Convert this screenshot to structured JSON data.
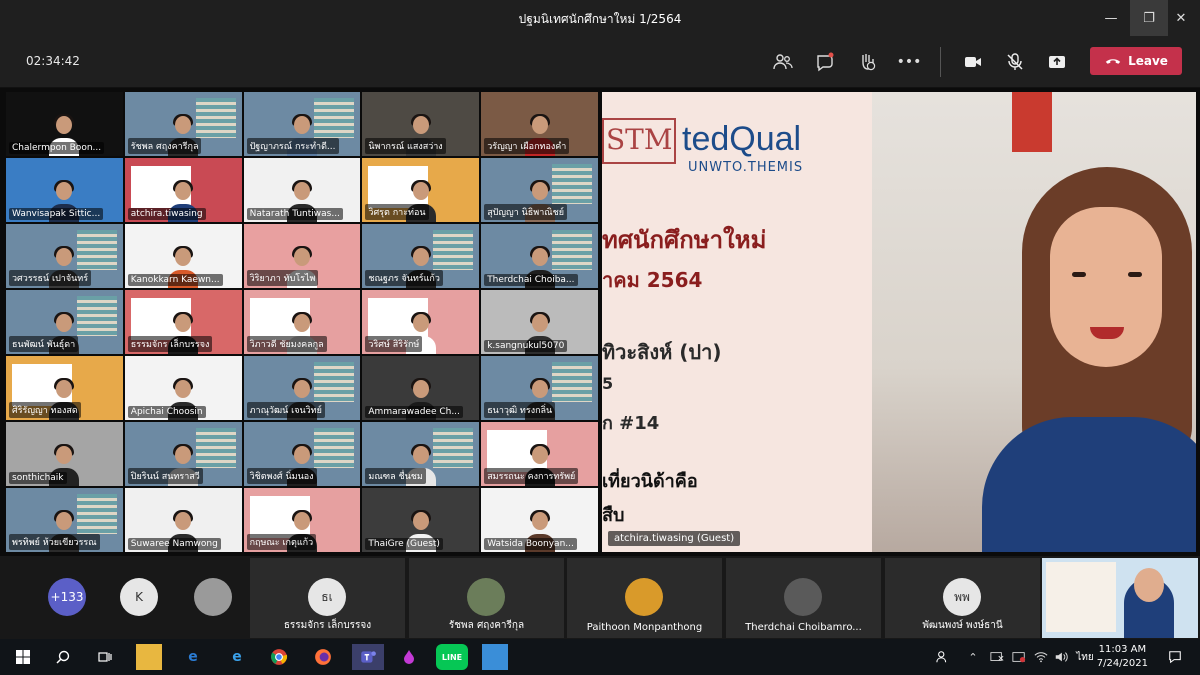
{
  "window": {
    "title": "ปฐมนิเทศนักศึกษาใหม่ 1/2564",
    "minimize": "—",
    "restore": "❐",
    "close": "✕"
  },
  "toolbar": {
    "timer": "02:34:42",
    "leave_label": "Leave",
    "more": "•••"
  },
  "grid": {
    "tiles": [
      {
        "name": "Chalermpon Boon...",
        "bg": "#111111",
        "shirt": "#ffffff"
      },
      {
        "name": "รัชพล ศฤงคารีกุล",
        "bg": "#6d8aa3",
        "shirt": "#2b2b2b"
      },
      {
        "name": "ปัฐญาภรณ์ กระทำดี...",
        "bg": "#6d8aa3",
        "shirt": "#5a7aa0"
      },
      {
        "name": "นิพากรณ์ แสงสว่าง",
        "bg": "#4e4a44",
        "shirt": "#3a3a3a"
      },
      {
        "name": "วรัญญา เผือกทองคำ",
        "bg": "#7b5a45",
        "shirt": "#c02626"
      },
      {
        "name": "Wanvisapak Sittic...",
        "bg": "#3a7dc4",
        "shirt": "#1d2d4c"
      },
      {
        "name": "atchira.tiwasing",
        "bg": "#c94a54",
        "shirt": "#1f3f7a"
      },
      {
        "name": "Natarath Tuntiwas...",
        "bg": "#f1f1f1",
        "shirt": "#2a2a2a"
      },
      {
        "name": "วิศรุต กาะท่อน",
        "bg": "#e7a94a",
        "shirt": "#2b2b2b"
      },
      {
        "name": "สุปัญญา นิธิพาณิชย์",
        "bg": "#6d8aa3",
        "shirt": "#8c6d5a"
      },
      {
        "name": "วศวรรธน์ เปาจันทร์",
        "bg": "#6d8aa3",
        "shirt": "#3b3b3b"
      },
      {
        "name": "Kanokkarn Kaewn...",
        "bg": "#f3f3f3",
        "shirt": "#d85a2a"
      },
      {
        "name": "วิริยาภา ทับโรไพ",
        "bg": "#e8a0a0",
        "shirt": "#ffffff"
      },
      {
        "name": "ชณฐภร จันทร์แก้ว",
        "bg": "#6d8aa3",
        "shirt": "#222222"
      },
      {
        "name": "Therdchai Choiba...",
        "bg": "#6d8aa3",
        "shirt": "#1f1f1f"
      },
      {
        "name": "ธนพัฒน์ พันธุ์ดา",
        "bg": "#6d8aa3",
        "shirt": "#2d2d2d"
      },
      {
        "name": "ธรรมจักร เล็กบรรจง",
        "bg": "#d86868",
        "shirt": "#1a1a1a"
      },
      {
        "name": "วิภาวดี ชัยมงคลกูล",
        "bg": "#e6a0a0",
        "shirt": "#c7c7c7"
      },
      {
        "name": "วริศษ์ สิริรักษ์",
        "bg": "#e6a0a0",
        "shirt": "#ffffff"
      },
      {
        "name": "k.sangnukul5070",
        "bg": "#bbbbbb",
        "shirt": "#2e2e2e"
      },
      {
        "name": "ศิริรัญญา ทองสด",
        "bg": "#e7a94a",
        "shirt": "#2b2b2b"
      },
      {
        "name": "Apichai Choosin",
        "bg": "#f3f3f3",
        "shirt": "#2b2b2b"
      },
      {
        "name": "ภาณุวัฒน์ เจนวิทย์",
        "bg": "#6d8aa3",
        "shirt": "#2b2b2b"
      },
      {
        "name": "Ammarawadee Ch...",
        "bg": "#3a3a3a",
        "shirt": "#1a1a1a"
      },
      {
        "name": "ธนาวุฒิ ทรงกลิ่น",
        "bg": "#6d8aa3",
        "shirt": "#2b2b2b"
      },
      {
        "name": "sonthichaik",
        "bg": "#a5a5a5",
        "shirt": "#222222"
      },
      {
        "name": "ปิยรินน์ สนทราสวี",
        "bg": "#6d8aa3",
        "shirt": "#d4d4d4"
      },
      {
        "name": "วิชิตพงศ์ นิ่มนอง",
        "bg": "#6d8aa3",
        "shirt": "#1f1f1f"
      },
      {
        "name": "มณฑล ชื่นชม",
        "bg": "#6d8aa3",
        "shirt": "#e6e6e6"
      },
      {
        "name": "สมรรถนะ คงการทรัพย์",
        "bg": "#e6a0a0",
        "shirt": "#1a1a1a"
      },
      {
        "name": "พรทิพย์ ห้วยเขียวรรณ",
        "bg": "#6d8aa3",
        "shirt": "#2b2b2b"
      },
      {
        "name": "Suwaree Namwong",
        "bg": "#f0f0f0",
        "shirt": "#2a2a2a"
      },
      {
        "name": "กฤษณะ เกตุแก้ว",
        "bg": "#e6a0a0",
        "shirt": "#222222"
      },
      {
        "name": "ThaiGre (Guest)",
        "bg": "#3c3c3c",
        "shirt": "#f2f2f2"
      },
      {
        "name": "Watsida Boonyan...",
        "bg": "#f3f3f3",
        "shirt": "#5b3a2a"
      }
    ]
  },
  "featured": {
    "name": "atchira.tiwasing (Guest)",
    "logo_main": "STM",
    "logo_brand": "tedQual",
    "logo_sub": "UNWTO.THEMIS",
    "slide_lines": [
      "ทศนักศึกษาใหม่",
      "าคม 2564",
      "ทิวะสิงห์ (ปา)",
      "5",
      "ก #14",
      "เที่ยวนิด้าคือ",
      "สืบ"
    ]
  },
  "participants_bar": {
    "overflow_count": "+133",
    "letter_avatar": "K",
    "cards": [
      {
        "name": "ธรรมจักร เล็กบรรจง",
        "initials": "ธเ",
        "color": "#e6e6e6",
        "text": "#333333"
      },
      {
        "name": "รัชพล ศฤงคารีกุล",
        "initials": "",
        "color": "#6b7d5a",
        "text": "#ffffff"
      },
      {
        "name": "Paithoon Monpanthong",
        "initials": "",
        "color": "#d99a2a",
        "text": "#ffffff"
      },
      {
        "name": "Therdchai Choibamro...",
        "initials": "",
        "color": "#5a5a5a",
        "text": "#ffffff"
      },
      {
        "name": "พัฒนพงษ์ พงษ์ธานี",
        "initials": "พพ",
        "color": "#e6e6e6",
        "text": "#333333"
      }
    ]
  },
  "taskbar": {
    "time": "11:03 AM",
    "date": "7/24/2021",
    "lang": "ไทย"
  }
}
